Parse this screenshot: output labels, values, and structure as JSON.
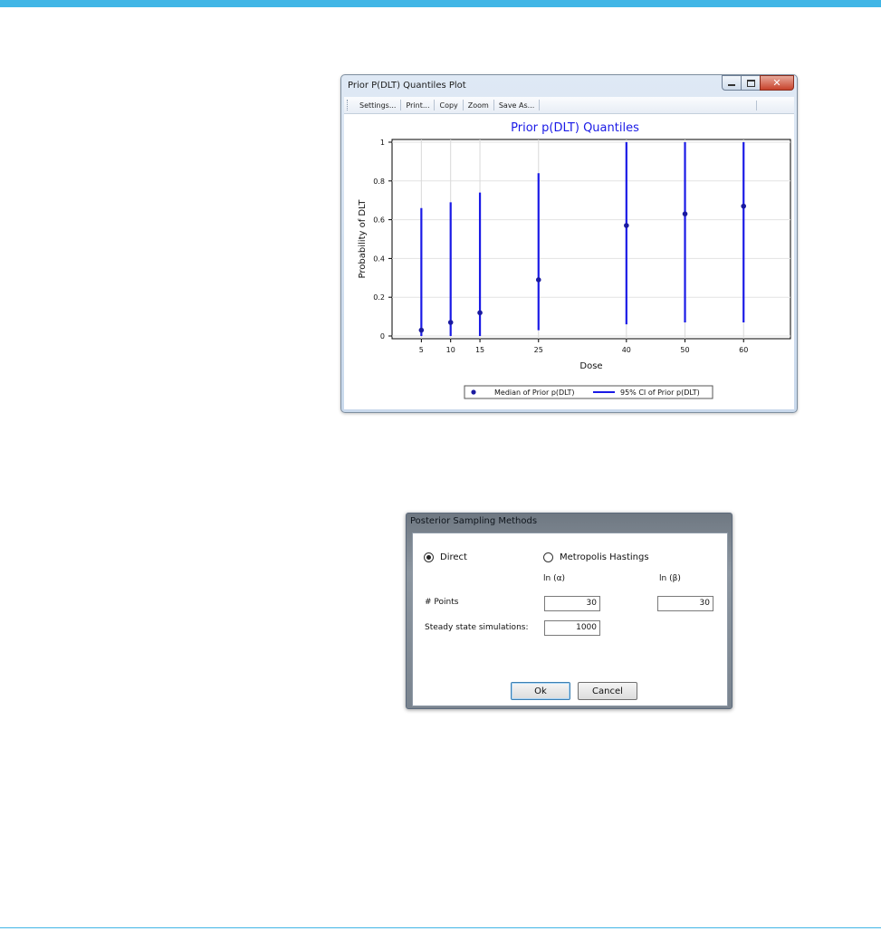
{
  "plot_window": {
    "title": "Prior P(DLT) Quantiles Plot",
    "toolbar": [
      "Settings...",
      "Print...",
      "Copy",
      "Zoom",
      "Save As..."
    ]
  },
  "chart_data": {
    "type": "scatter",
    "title": "Prior p(DLT) Quantiles",
    "xlabel": "Dose",
    "ylabel": "Probability of DLT",
    "x": [
      5,
      10,
      15,
      25,
      40,
      50,
      60
    ],
    "x_ticks": [
      "5",
      "10",
      "15",
      "25",
      "40",
      "50",
      "60"
    ],
    "y_ticks": [
      "0",
      "0.2",
      "0.4",
      "0.6",
      "0.8",
      "1"
    ],
    "xlim": [
      0,
      68
    ],
    "ylim": [
      0,
      1
    ],
    "grid": "vertical at doses and horizontal at y ticks",
    "series": [
      {
        "name": "Median of Prior p(DLT)",
        "marker": "dot",
        "values": [
          0.03,
          0.07,
          0.12,
          0.29,
          0.57,
          0.63,
          0.67
        ]
      },
      {
        "name": "95% CI of Prior p(DLT)",
        "marker": "line",
        "lower": [
          0.0,
          0.0,
          0.0,
          0.03,
          0.06,
          0.07,
          0.07
        ],
        "upper": [
          0.66,
          0.69,
          0.74,
          0.84,
          1.0,
          1.0,
          1.0
        ]
      }
    ],
    "legend_position": "bottom-center",
    "colors": {
      "series": "#1a1ae6",
      "median": "#1a1aa0",
      "title": "#1a1ae6"
    }
  },
  "dialog": {
    "title": "Posterior Sampling Methods",
    "radio_direct": "Direct",
    "radio_mh": "Metropolis Hastings",
    "selected": "Direct",
    "col_alpha": "ln (α)",
    "col_beta": "ln (β)",
    "points_label": "# Points",
    "points_alpha": "30",
    "points_beta": "30",
    "steady_label": "Steady state simulations:",
    "steady_value": "1000",
    "ok_label": "Ok",
    "cancel_label": "Cancel"
  }
}
